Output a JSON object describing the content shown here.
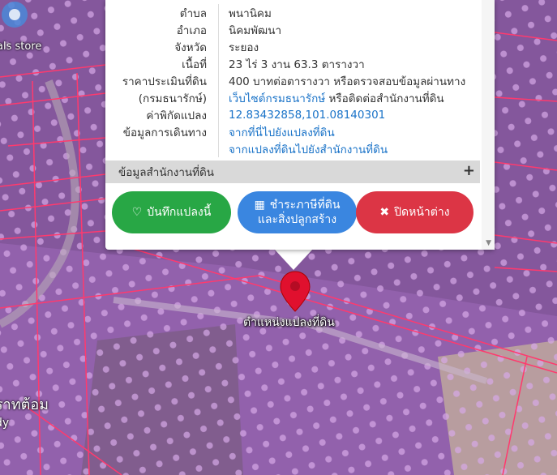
{
  "map": {
    "store_label": "als store",
    "area_label_line1": "ราทต้อม",
    "area_label_line2": "dy",
    "pin_label": "ตำแหน่งแปลงที่ดิน"
  },
  "popup": {
    "rows": [
      {
        "key": "ตำบล",
        "value": "พนานิคม"
      },
      {
        "key": "อำเภอ",
        "value": "นิคมพัฒนา"
      },
      {
        "key": "จังหวัด",
        "value": "ระยอง"
      },
      {
        "key": "เนื้อที่",
        "value": "23 ไร่ 3 งาน 63.3 ตารางวา"
      },
      {
        "key": "ราคาประเมินที่ดิน",
        "value": "400 บาทต่อตารางวา หรือตรวจสอบข้อมูลผ่านทาง"
      },
      {
        "key": "(กรมธนารักษ์)",
        "value_link": "เว็บไซต์กรมธนารักษ์",
        "value_rest": " หรือติดต่อสำนักงานที่ดิน"
      },
      {
        "key": "ค่าพิกัดแปลง",
        "value_link": "12.83432858,101.08140301"
      },
      {
        "key": "ข้อมูลการเดินทาง",
        "value_link": "จากที่นี่ไปยังแปลงที่ดิน"
      },
      {
        "key": "",
        "value_link": "จากแปลงที่ดินไปยังสำนักงานที่ดิน"
      }
    ],
    "section_title": "ข้อมูลสำนักงานที่ดิน",
    "section_toggle": "+",
    "buttons": {
      "save": "บันทึกแปลงนี้",
      "pay": "ชำระภาษีที่ดินและสิ่งปลูกสร้าง",
      "close": "ปิดหน้าต่าง"
    },
    "icons": {
      "save": "heart-icon",
      "pay": "qr-icon",
      "close": "close-icon"
    }
  },
  "colors": {
    "save": "#28a745",
    "pay": "#3a86e0",
    "close": "#dc3545",
    "pin": "#e0102e",
    "overlay": "#9b4fc4",
    "parcel_line": "#ff3a6e"
  }
}
